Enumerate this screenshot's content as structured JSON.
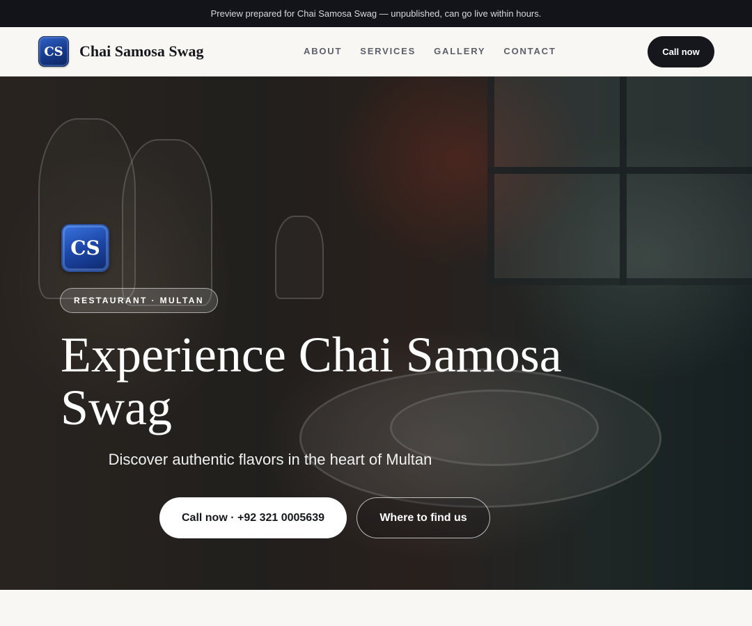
{
  "preview_bar": {
    "text": "Preview prepared for Chai Samosa Swag — unpublished, can go live within hours."
  },
  "nav": {
    "logo_initials": "CS",
    "brand_name": "Chai Samosa Swag",
    "links": [
      {
        "label": "ABOUT"
      },
      {
        "label": "SERVICES"
      },
      {
        "label": "GALLERY"
      },
      {
        "label": "CONTACT"
      }
    ],
    "cta_label": "Call now"
  },
  "hero": {
    "logo_initials": "CS",
    "badge": "RESTAURANT · MULTAN",
    "title": "Experience Chai Samosa Swag",
    "subtitle": "Discover authentic flavors in the heart of Multan",
    "primary_button": "Call now · +92 321 0005639",
    "secondary_button": "Where to find us",
    "background_image": "restaurant-table-photo"
  },
  "colors": {
    "preview_bar_bg": "#121419",
    "nav_bg": "#f8f7f3",
    "dark_button": "#15171c",
    "logo_blue": "#1c46a6",
    "page_bg": "#f8f7f3"
  }
}
